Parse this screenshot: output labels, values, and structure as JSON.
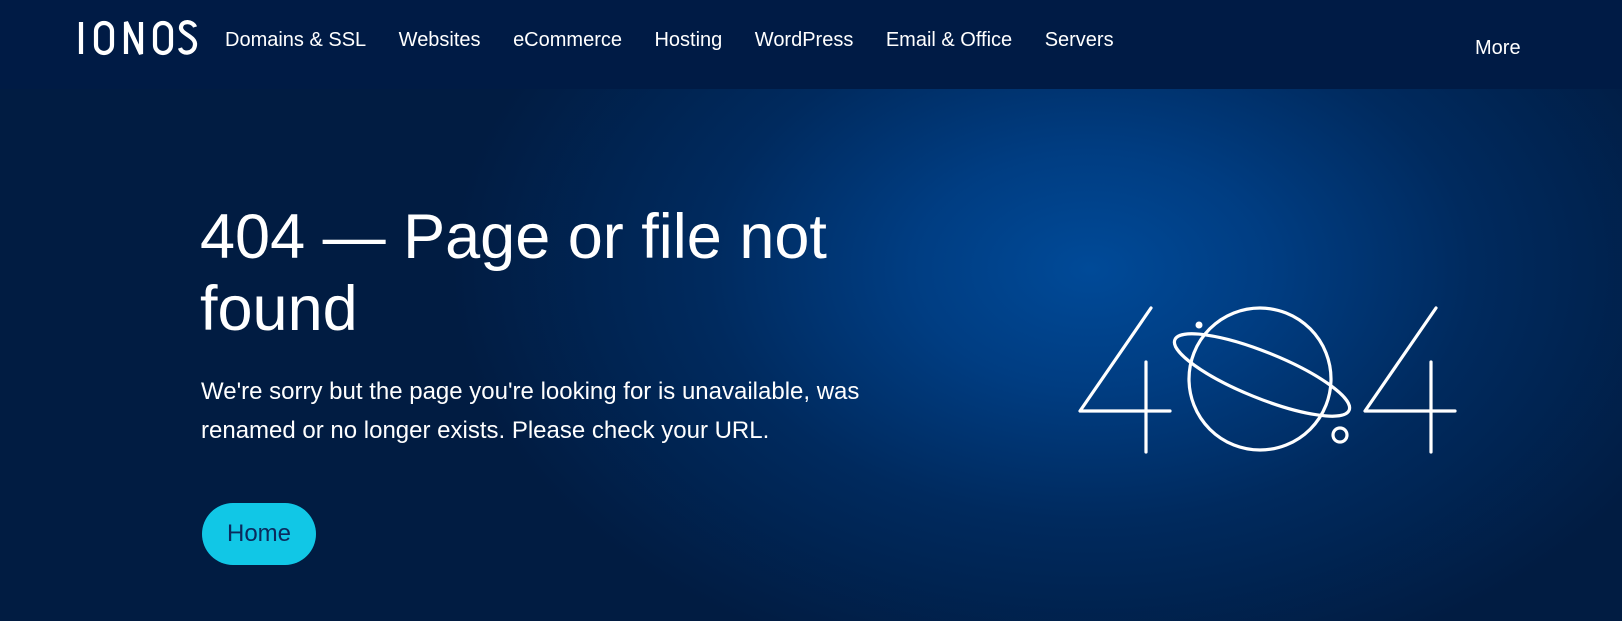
{
  "header": {
    "logo_text": "IONOS",
    "nav_items": [
      {
        "label": "Domains & SSL"
      },
      {
        "label": "Websites"
      },
      {
        "label": "eCommerce"
      },
      {
        "label": "Hosting"
      },
      {
        "label": "WordPress"
      },
      {
        "label": "Email & Office"
      },
      {
        "label": "Servers"
      }
    ],
    "more_label": "More"
  },
  "main": {
    "title": "404 — Page or file not found",
    "description": "We're sorry but the page you're looking for is unavailable, was renamed or no longer exists. Please check your URL.",
    "home_button": "Home",
    "illustration_icon": "404-planet-illustration"
  },
  "colors": {
    "nav_background": "#001b45",
    "hero_center": "#004a98",
    "hero_edge": "#011c42",
    "button": "#11c7e6",
    "button_text": "#0b2a5c",
    "text": "#ffffff"
  }
}
